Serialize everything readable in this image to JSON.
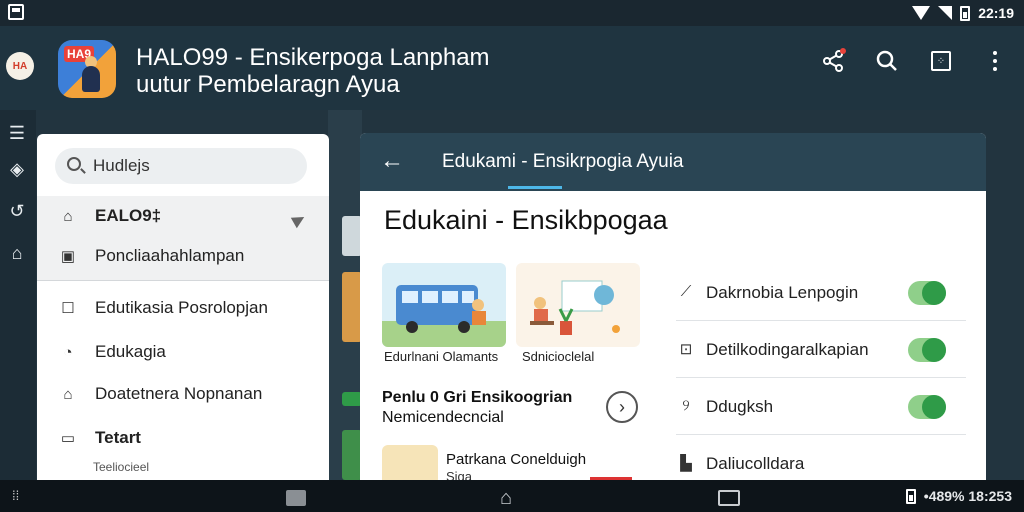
{
  "status_bar": {
    "time": "22:19"
  },
  "app_bar": {
    "title_line1": "HALO99 - Ensikerpoga Lanpham",
    "title_line2": "uutur Pembelaragn Ayua",
    "logo_text": "HA9",
    "badge_text": "HA"
  },
  "drawer": {
    "search_text": "Hudlejs",
    "items": [
      {
        "label": "EALO9‡",
        "icon": "home-alert-icon"
      },
      {
        "label": "Poncliaahahlampan",
        "icon": "calendar-icon"
      },
      {
        "label": "Edutikasia Posrolopjan",
        "icon": "square-icon"
      },
      {
        "label": "Edukagia",
        "icon": "folder-icon"
      },
      {
        "label": "Doatetnera Nopnanan",
        "icon": "house-icon"
      },
      {
        "label": "Tetart",
        "icon": "briefcase-icon"
      }
    ],
    "footer": "Teeliocieel"
  },
  "card": {
    "header_title": "Edukami - Ensikrpogia Ayuia",
    "title": "Edukaini - Ensikbpogaa",
    "thumbnails": [
      {
        "caption": "Edurlnani Olamants"
      },
      {
        "caption": "Sdnicioclelal"
      }
    ],
    "recommendation": {
      "title": "Penlu 0 Gri  Ensikoogrian",
      "subtitle": "Nemicendecncial"
    },
    "item": {
      "title": "Patrkana Conelduigh",
      "subtitle": "Siga"
    },
    "toggles": [
      {
        "label": "Dakrnobia Lenpogin",
        "icon": "chart-icon",
        "on": true
      },
      {
        "label": "Detilkodingaralkapian",
        "icon": "box-icon",
        "on": true
      },
      {
        "label": "Ddugksh",
        "icon": "pin-icon",
        "on": true
      },
      {
        "label": "Daliucolldara",
        "icon": "doc-icon",
        "on": false
      }
    ]
  },
  "nav_bar": {
    "right_text": "•489%  18:253"
  }
}
